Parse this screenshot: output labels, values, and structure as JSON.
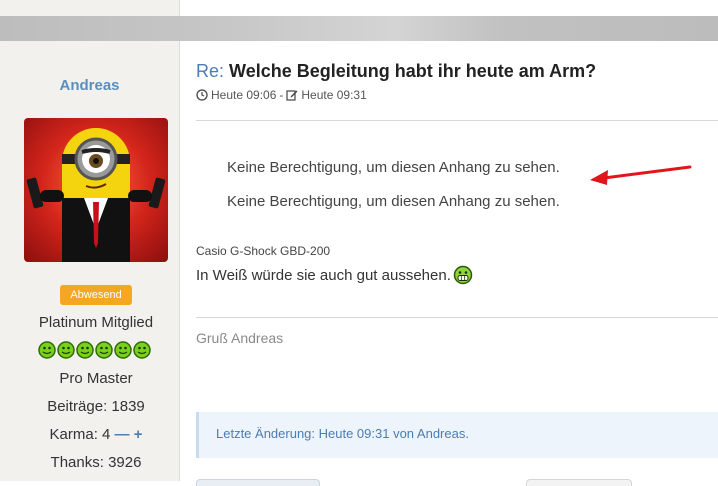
{
  "user": {
    "name": "Andreas",
    "status": "Abwesend",
    "rank": "Platinum Mitglied",
    "title": "Pro Master",
    "posts": "Beiträge: 1839",
    "karma": "Karma: 4",
    "karma_minus": "—",
    "karma_plus": "+",
    "thanks": "Thanks: 3926"
  },
  "post": {
    "title_prefix": "Re:",
    "title": "Welche Begleitung habt ihr heute am Arm?",
    "created": "Heute 09:06",
    "separator": "-",
    "edited": "Heute 09:31",
    "attachments": [
      "Keine Berechtigung, um diesen Anhang zu sehen.",
      "Keine Berechtigung, um diesen Anhang zu sehen."
    ],
    "watch_label": "Casio G-Shock GBD-200",
    "text": "In Weiß würde sie auch gut aussehen.",
    "signature": "Gruß Andreas",
    "edit_note": "Letzte Änderung: Heute 09:31 von Andreas."
  },
  "colors": {
    "link_blue": "#4a7db5",
    "username_blue": "#5a8fbd",
    "badge_orange": "#f5a623",
    "sidebar_bg": "#f2f1ee",
    "edit_box_bg": "#eef4fb",
    "arrow_red": "#e3141c"
  },
  "icons": [
    "clock-icon",
    "edit-icon",
    "grin-smiley-icon",
    "green-star-icon",
    "red-arrow-annotation"
  ]
}
